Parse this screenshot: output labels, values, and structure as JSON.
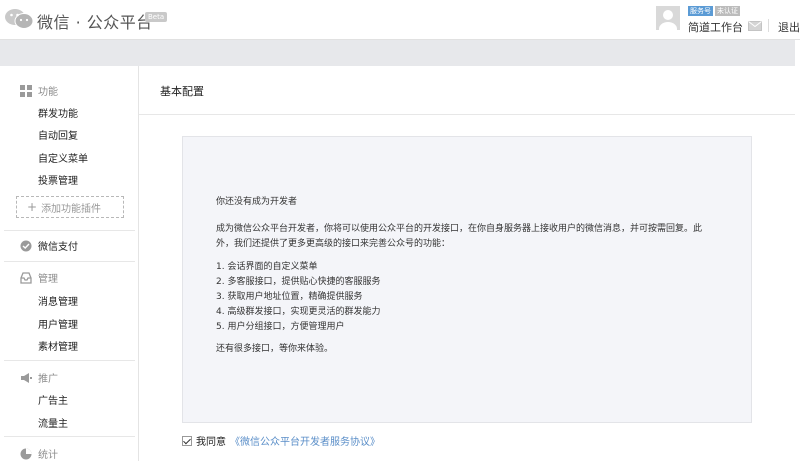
{
  "header": {
    "brand": "微信 · 公众平台",
    "beta": "Beta",
    "badge_service": "服务号",
    "badge_unverified": "未认证",
    "account_name": "简道工作台",
    "logout": "退出"
  },
  "sidebar": {
    "features": {
      "title": "功能",
      "items": [
        "群发功能",
        "自动回复",
        "自定义菜单",
        "投票管理"
      ],
      "add": "添加功能插件"
    },
    "pay": {
      "title": "微信支付"
    },
    "manage": {
      "title": "管理",
      "items": [
        "消息管理",
        "用户管理",
        "素材管理"
      ]
    },
    "promote": {
      "title": "推广",
      "items": [
        "广告主",
        "流量主"
      ]
    },
    "stats": {
      "title": "统计"
    }
  },
  "main": {
    "title": "基本配置",
    "intro": "你还没有成为开发者",
    "desc_line1": "成为微信公众平台开发者，你将可以使用公众平台的开发接口，在你自身服务器上接收用户的微信消息，并可按需回复。此",
    "desc_line2": "外，我们还提供了更多更高级的接口来完善公众号的功能：",
    "features": [
      "1. 会话界面的自定义菜单",
      "2. 多客服接口，提供贴心快捷的客服服务",
      "3. 获取用户地址位置，精确提供服务",
      "4. 高级群发接口，实现更灵活的群发能力",
      "5. 用户分组接口，方便管理用户"
    ],
    "outro": "还有很多接口，等你来体验。",
    "agree_label": "我同意",
    "agree_link": "《微信公众平台开发者服务协议》"
  }
}
